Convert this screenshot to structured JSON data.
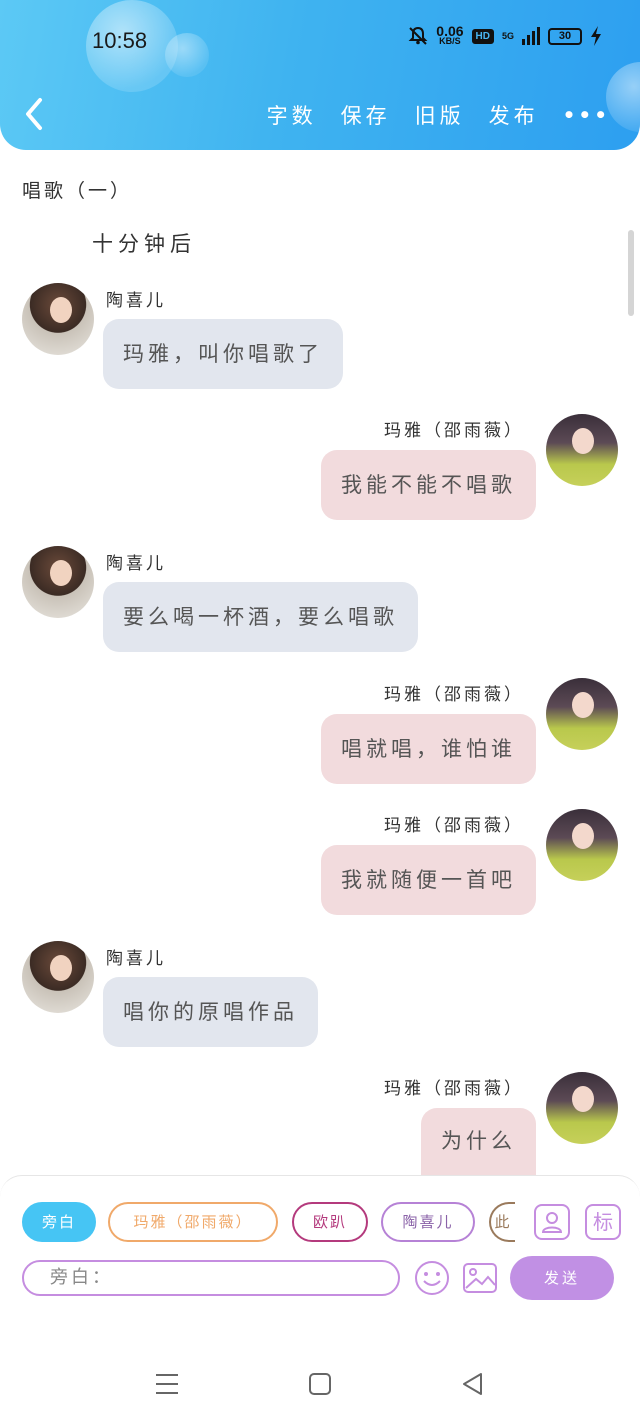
{
  "status_bar": {
    "time": "10:58",
    "speed_value": "0.06",
    "speed_unit": "KB/S",
    "hd_label": "HD",
    "network": "5G",
    "battery": "30"
  },
  "header": {
    "actions": [
      "字数",
      "保存",
      "旧版",
      "发布"
    ],
    "more": "•••"
  },
  "chat": {
    "scene_title": "唱歌（一）",
    "narration": "十分钟后",
    "messages": [
      {
        "side": "left",
        "name": "陶喜儿",
        "text": "玛雅，叫你唱歌了"
      },
      {
        "side": "right",
        "name": "玛雅（邵雨薇）",
        "text": "我能不能不唱歌"
      },
      {
        "side": "left",
        "name": "陶喜儿",
        "text": "要么喝一杯酒，要么唱歌"
      },
      {
        "side": "right",
        "name": "玛雅（邵雨薇）",
        "text": "唱就唱，谁怕谁"
      },
      {
        "side": "right",
        "name": "玛雅（邵雨薇）",
        "text": "我就随便一首吧"
      },
      {
        "side": "left",
        "name": "陶喜儿",
        "text": "唱你的原唱作品"
      },
      {
        "side": "right",
        "name": "玛雅（邵雨薇）",
        "text": "为什么"
      }
    ]
  },
  "composer": {
    "chips": [
      "旁白",
      "玛雅（邵雨薇）",
      "欧趴",
      "陶喜儿",
      "此"
    ],
    "mark_label": "标",
    "input_placeholder": "旁白：",
    "send_label": "发送"
  }
}
